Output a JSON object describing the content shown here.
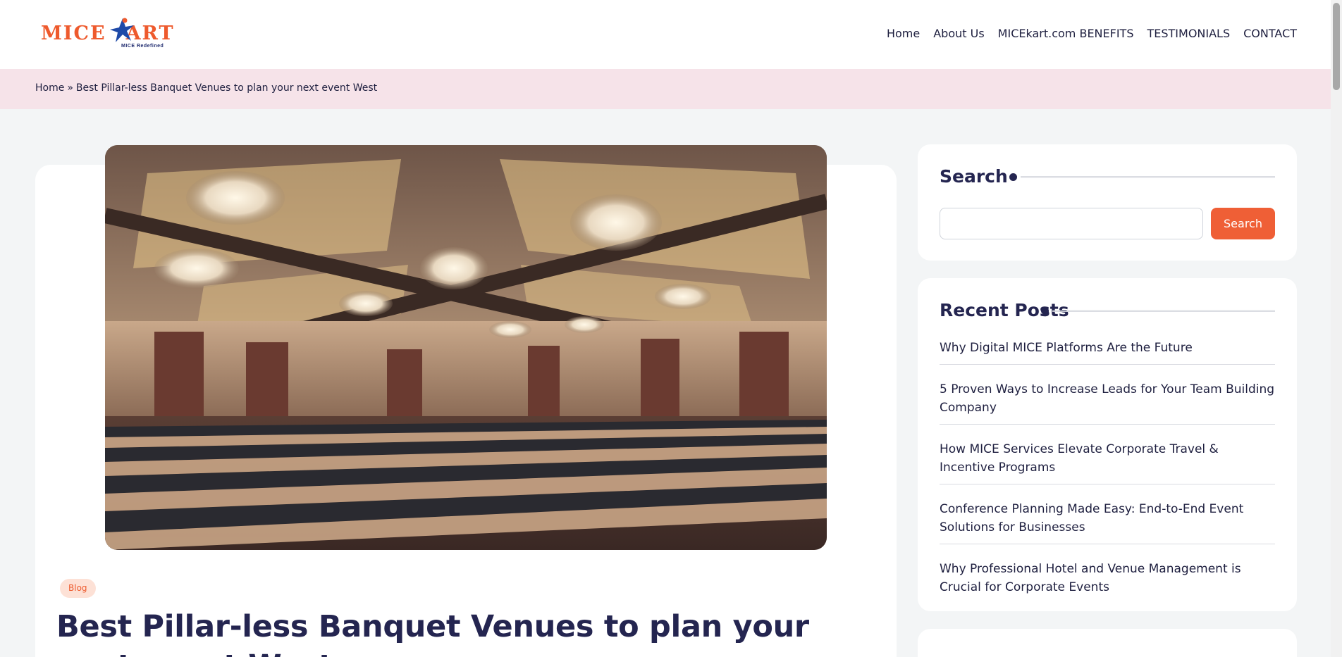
{
  "header": {
    "logo": {
      "text": "MICE",
      "text2": "ART",
      "tagline": "MICE Redefined"
    },
    "nav": [
      {
        "label": "Home"
      },
      {
        "label": "About Us"
      },
      {
        "label": "MICEkart.com BENEFITS"
      },
      {
        "label": "TESTIMONIALS"
      },
      {
        "label": "CONTACT"
      }
    ]
  },
  "breadcrumb": {
    "home": "Home",
    "separator": "»",
    "current": "Best Pillar-less Banquet Venues to plan your next event West"
  },
  "article": {
    "category": "Blog",
    "title": "Best Pillar-less Banquet Venues to plan your next event West"
  },
  "sidebar": {
    "search": {
      "title": "Search",
      "input_value": "",
      "button_label": "Search"
    },
    "recent_posts": {
      "title": "Recent Posts",
      "items": [
        {
          "label": "Why Digital MICE Platforms Are the Future"
        },
        {
          "label": "5 Proven Ways to Increase Leads for Your Team Building Company"
        },
        {
          "label": "How MICE Services Elevate Corporate Travel & Incentive Programs"
        },
        {
          "label": "Conference Planning Made Easy: End-to-End Event Solutions for Businesses"
        },
        {
          "label": "Why Professional Hotel and Venue Management is Crucial for Corporate Events"
        }
      ]
    }
  },
  "colors": {
    "accent": "#ef5f36",
    "navy": "#242550",
    "breadcrumb_bg": "#f6e3e9"
  }
}
